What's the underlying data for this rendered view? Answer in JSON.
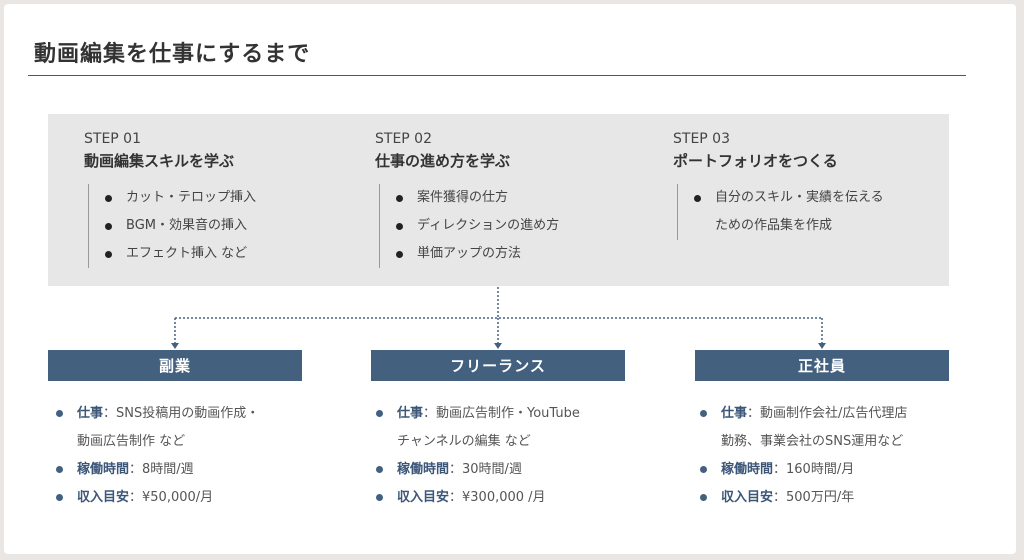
{
  "title": "動画編集を仕事にするまで",
  "steps": [
    {
      "label": "STEP 01",
      "title": "動画編集スキルを学ぶ",
      "items": [
        "カット・テロップ挿入",
        "BGM・効果音の挿入",
        "エフェクト挿入 など"
      ]
    },
    {
      "label": "STEP 02",
      "title": "仕事の進め方を学ぶ",
      "items": [
        "案件獲得の仕方",
        "ディレクションの進め方",
        "単価アップの方法"
      ]
    },
    {
      "label": "STEP 03",
      "title": "ポートフォリオをつくる",
      "items": [
        "自分のスキル・実績を伝える",
        "ための作品集を作成"
      ]
    }
  ],
  "paths": [
    {
      "name": "副業",
      "work_key": "仕事",
      "work_line1": "：SNS投稿用の動画作成・",
      "work_line2": "動画広告制作 など",
      "hours_key": "稼働時間",
      "hours_value": "：8時間/週",
      "income_key": "収入目安",
      "income_value": "：¥50,000/月"
    },
    {
      "name": "フリーランス",
      "work_key": "仕事",
      "work_line1": "：動画広告制作・YouTube",
      "work_line2": "チャンネルの編集 など",
      "hours_key": "稼働時間",
      "hours_value": "：30時間/週",
      "income_key": "収入目安",
      "income_value": "：¥300,000 /月"
    },
    {
      "name": "正社員",
      "work_key": "仕事",
      "work_line1": "：動画制作会社/広告代理店",
      "work_line2": "勤務、事業会社のSNS運用など",
      "hours_key": "稼働時間",
      "hours_value": "：160時間/月",
      "income_key": "収入目安",
      "income_value": "：500万円/年"
    }
  ],
  "colors": {
    "accent": "#44607f",
    "panel": "#e7e7e7",
    "connector": "#44607f"
  }
}
